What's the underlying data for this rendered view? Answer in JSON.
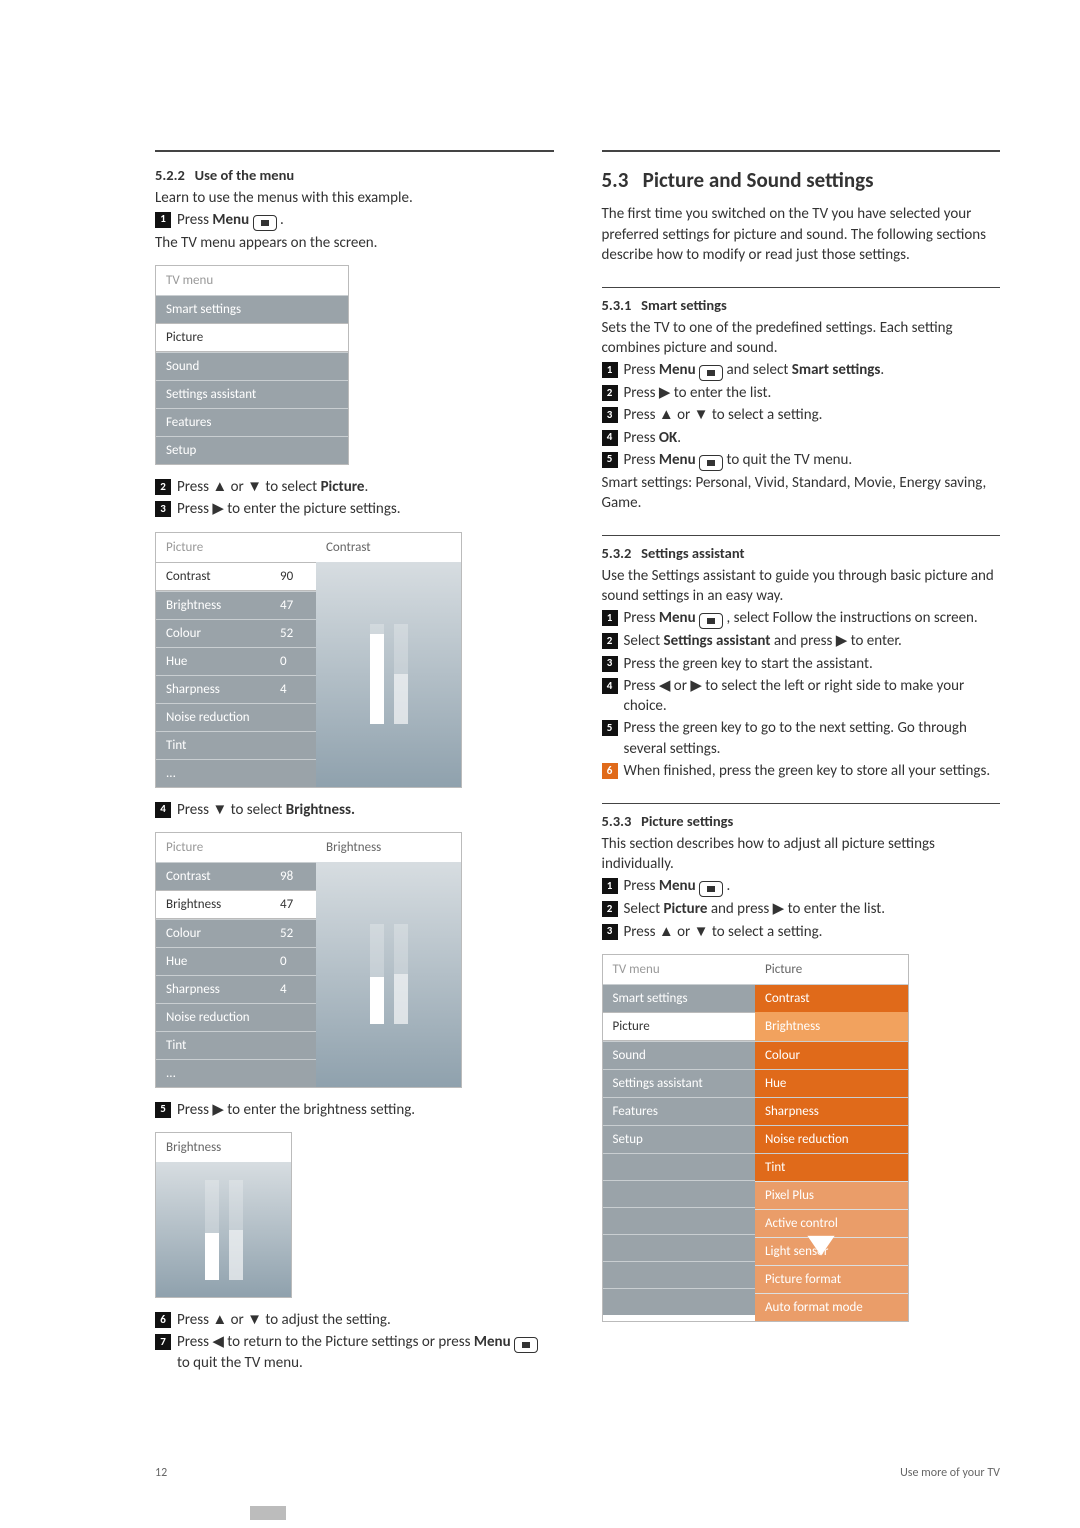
{
  "footer": {
    "page_number": "12",
    "section": "Use more of your TV"
  },
  "left": {
    "s522": {
      "num": "5.2.2",
      "title": "Use of the menu",
      "intro": "Learn to use the menus with this example.",
      "step1_pre": "Press ",
      "step1_bold": "Menu",
      "step1_post": " .",
      "after1": "The TV menu appears on the screen.",
      "tvmenu": {
        "title": "TV menu",
        "items": [
          "Smart settings",
          "Picture",
          "Sound",
          "Settings assistant",
          "Features",
          "Setup"
        ],
        "selected_index": 1
      },
      "step2": "Press ▲ or ▼ to select ",
      "step2_bold": "Picture",
      "step2_end": ".",
      "step3": "Press ▶ to enter the picture settings.",
      "panel_contrast": {
        "left_title": "Picture",
        "right_title": "Contrast",
        "rows": [
          {
            "label": "Contrast",
            "value": "90",
            "selected": true
          },
          {
            "label": "Brightness",
            "value": "47"
          },
          {
            "label": "Colour",
            "value": "52"
          },
          {
            "label": "Hue",
            "value": "0"
          },
          {
            "label": "Sharpness",
            "value": "4"
          },
          {
            "label": "Noise reduction",
            "value": ""
          },
          {
            "label": "Tint",
            "value": ""
          },
          {
            "label": "...",
            "value": ""
          }
        ],
        "bar_left_pct": 90,
        "bar_right_pct": 50
      },
      "step4": "Press ▼ to select ",
      "step4_bold": "Brightness.",
      "panel_brightness": {
        "left_title": "Picture",
        "right_title": "Brightness",
        "rows": [
          {
            "label": "Contrast",
            "value": "98"
          },
          {
            "label": "Brightness",
            "value": "47",
            "selected": true
          },
          {
            "label": "Colour",
            "value": "52"
          },
          {
            "label": "Hue",
            "value": "0"
          },
          {
            "label": "Sharpness",
            "value": "4"
          },
          {
            "label": "Noise reduction",
            "value": ""
          },
          {
            "label": "Tint",
            "value": ""
          },
          {
            "label": "...",
            "value": ""
          }
        ],
        "bar_left_pct": 47,
        "bar_right_pct": 50
      },
      "step5": "Press ▶ to enter the brightness setting.",
      "panel_single": {
        "title": "Brightness",
        "bar_left_pct": 47,
        "bar_right_pct": 50
      },
      "step6": "Press ▲ or ▼ to adjust the setting.",
      "step7a": "Press ◀ to return to the Picture settings or press ",
      "step7_bold": "Menu",
      "step7b": " to quit the TV menu."
    }
  },
  "right": {
    "s53": {
      "num": "5.3",
      "title": "Picture and Sound settings",
      "intro": "The first time you switched on the TV you have selected your preferred settings for picture and sound. The following sections describe how to modify or read just those settings."
    },
    "s531": {
      "num": "5.3.1",
      "title": "Smart settings",
      "intro": "Sets the TV to one of the predefined settings. Each setting combines picture and sound.",
      "step1_pre": "Press ",
      "step1_b1": "Menu",
      "step1_mid": " and select ",
      "step1_b2": "Smart settings",
      "step1_end": ".",
      "step2": "Press ▶ to enter the list.",
      "step3": "Press ▲ or ▼ to select a setting.",
      "step4_pre": "Press ",
      "step4_b": "OK",
      "step4_end": ".",
      "step5_pre": "Press ",
      "step5_b": "Menu",
      "step5_end": " to quit the TV menu.",
      "list": "Smart settings: Personal, Vivid, Standard, Movie, Energy saving, Game."
    },
    "s532": {
      "num": "5.3.2",
      "title": "Settings assistant",
      "intro": "Use the Settings assistant to guide you through basic picture and sound settings in an easy way.",
      "step1_pre": "Press ",
      "step1_b": "Menu",
      "step1_end": " , select Follow the instructions on screen.",
      "step2_pre": "Select ",
      "step2_b": "Settings assistant",
      "step2_end": " and press ▶ to enter.",
      "step3": "Press the green key to start the assistant.",
      "step4": "Press ◀ or ▶ to select the left or right side to make your choice.",
      "step5": "Press the green key to go to the next setting. Go through several settings.",
      "step6": "When finished, press the green key to store all your settings."
    },
    "s533": {
      "num": "5.3.3",
      "title": "Picture settings",
      "intro": "This section describes how to adjust all picture settings individually.",
      "step1_pre": "Press ",
      "step1_b": "Menu",
      "step1_end": " .",
      "step2_pre": "Select ",
      "step2_b": "Picture",
      "step2_end": " and press ▶ to enter the list.",
      "step3": "Press ▲ or ▼ to select a setting.",
      "panel": {
        "left_title": "TV menu",
        "right_title": "Picture",
        "left_items": [
          "Smart settings",
          "Picture",
          "Sound",
          "Settings assistant",
          "Features",
          "Setup"
        ],
        "left_selected_index": 1,
        "right_items": [
          "Contrast",
          "Brightness",
          "Colour",
          "Hue",
          "Sharpness",
          "Noise reduction",
          "Tint",
          "Pixel Plus",
          "Active control",
          "Light sensor",
          "Picture format",
          "Auto format mode"
        ],
        "right_selected_index": 1
      }
    }
  }
}
